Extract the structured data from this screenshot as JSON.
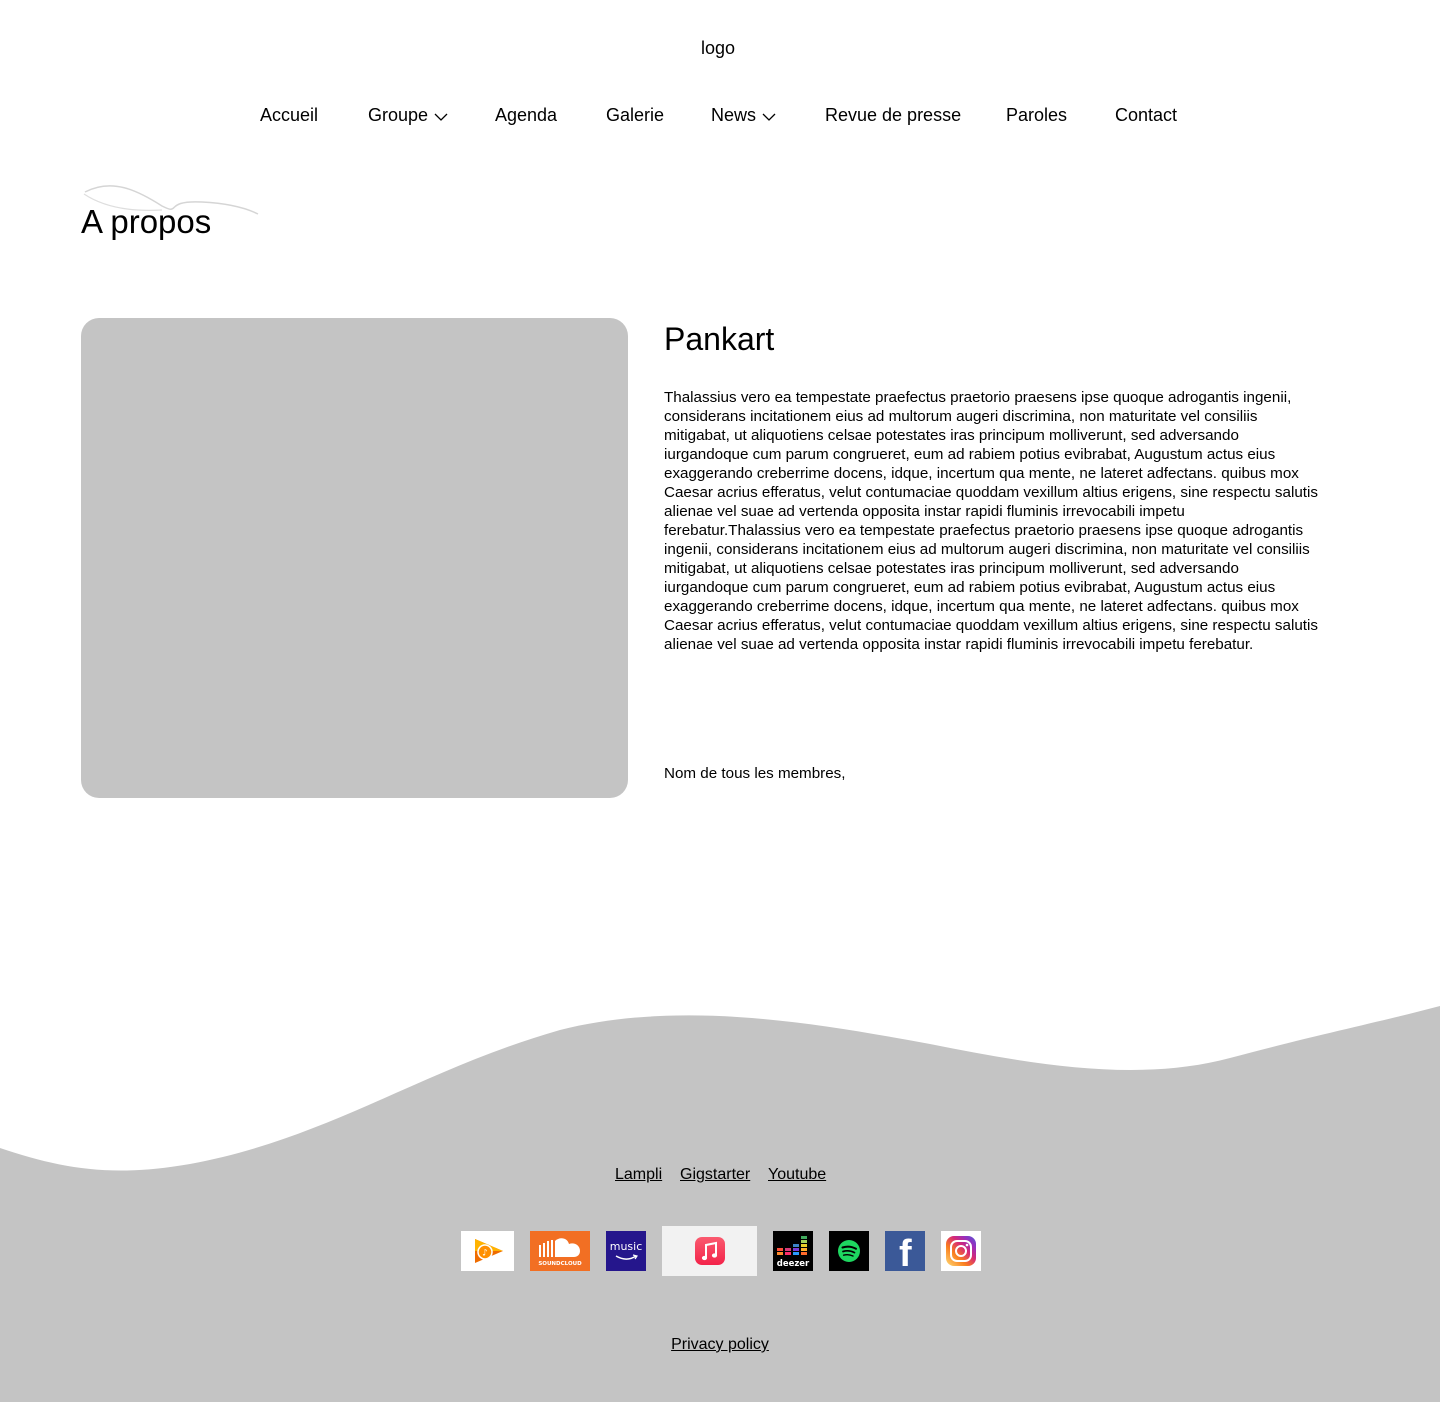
{
  "header": {
    "logo_text": "logo"
  },
  "nav": {
    "items": [
      {
        "label": "Accueil",
        "has_dropdown": false
      },
      {
        "label": "Groupe",
        "has_dropdown": true
      },
      {
        "label": "Agenda",
        "has_dropdown": false
      },
      {
        "label": "Galerie",
        "has_dropdown": false
      },
      {
        "label": "News",
        "has_dropdown": true
      },
      {
        "label": "Revue de presse",
        "has_dropdown": false
      },
      {
        "label": "Paroles",
        "has_dropdown": false
      },
      {
        "label": "Contact",
        "has_dropdown": false
      }
    ]
  },
  "page": {
    "title": "A propos"
  },
  "about": {
    "band_name": "Pankart",
    "description": "Thalassius vero ea tempestate praefectus praetorio praesens ipse quoque adrogantis ingenii, considerans incitationem eius ad multorum augeri discrimina, non maturitate vel consiliis mitigabat, ut aliquotiens celsae potestates iras principum molliverunt, sed adversando iurgandoque cum parum congrueret, eum ad rabiem potius evibrabat, Augustum actus eius exaggerando creberrime docens, idque, incertum qua mente, ne lateret adfectans. quibus mox Caesar acrius efferatus, velut contumaciae quoddam vexillum altius erigens, sine respectu salutis alienae vel suae ad vertenda opposita instar rapidi fluminis irrevocabili impetu ferebatur.Thalassius vero ea tempestate praefectus praetorio praesens ipse quoque adrogantis ingenii, considerans incitationem eius ad multorum augeri discrimina, non maturitate vel consiliis mitigabat, ut aliquotiens celsae potestates iras principum molliverunt, sed adversando iurgandoque cum parum congrueret, eum ad rabiem potius evibrabat, Augustum actus eius exaggerando creberrime docens, idque, incertum qua mente, ne lateret adfectans. quibus mox Caesar acrius efferatus, velut contumaciae quoddam vexillum altius erigens, sine respectu salutis alienae vel suae ad vertenda opposita instar rapidi fluminis irrevocabili impetu ferebatur.",
    "members": "Nom de tous les membres,"
  },
  "footer": {
    "links": [
      "Lampli",
      "Gigstarter",
      "Youtube"
    ],
    "platforms": [
      {
        "icon": "google-play-music-icon"
      },
      {
        "icon": "soundcloud-icon",
        "text": "SOUNDCLOUD"
      },
      {
        "icon": "amazon-music-icon",
        "text": "music"
      },
      {
        "icon": "apple-music-icon"
      },
      {
        "icon": "deezer-icon",
        "text": "deezer"
      },
      {
        "icon": "spotify-icon"
      },
      {
        "icon": "facebook-icon",
        "text": "f"
      },
      {
        "icon": "instagram-icon"
      }
    ],
    "privacy": "Privacy policy"
  },
  "colors": {
    "placeholder_gray": "#c4c4c4",
    "footer_gray": "#c4c4c4",
    "soundcloud_orange": "#f26f23",
    "amazon_purple": "#25168c",
    "spotify_green": "#1ed760",
    "facebook_blue": "#3b5998",
    "apple_red": "#fa3c55"
  }
}
